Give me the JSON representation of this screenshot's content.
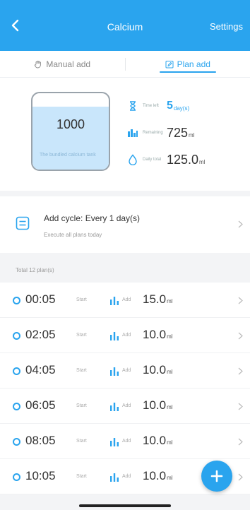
{
  "header": {
    "title": "Calcium",
    "settings_label": "Settings"
  },
  "tabs": [
    {
      "label": "Manual add",
      "icon": "hand-icon",
      "active": false
    },
    {
      "label": "Plan add",
      "icon": "calendar-edit-icon",
      "active": true
    }
  ],
  "summary": {
    "tank_volume": "1000",
    "tank_note": "The bundled calcium tank",
    "tank_fill_fraction": 0.82,
    "stats": [
      {
        "icon": "hourglass-icon",
        "label": "Time left",
        "value": "5",
        "unit": "day(s)",
        "highlight": true
      },
      {
        "icon": "bars-icon",
        "label": "Remaining",
        "value": "725",
        "unit": "ml",
        "highlight": false
      },
      {
        "icon": "drop-icon",
        "label": "Daily total",
        "value": "125.0",
        "unit": "ml",
        "highlight": false
      }
    ]
  },
  "cycle": {
    "title": "Add cycle: Every 1 day(s)",
    "subtitle": "Execute all plans today"
  },
  "total_label": "Total 12 plan(s)",
  "plans": [
    {
      "time": "00:05",
      "start_label": "Start",
      "add_label": "Add",
      "amount": "15.0",
      "unit": "ml"
    },
    {
      "time": "02:05",
      "start_label": "Start",
      "add_label": "Add",
      "amount": "10.0",
      "unit": "ml"
    },
    {
      "time": "04:05",
      "start_label": "Start",
      "add_label": "Add",
      "amount": "10.0",
      "unit": "ml"
    },
    {
      "time": "06:05",
      "start_label": "Start",
      "add_label": "Add",
      "amount": "10.0",
      "unit": "ml"
    },
    {
      "time": "08:05",
      "start_label": "Start",
      "add_label": "Add",
      "amount": "10.0",
      "unit": "ml"
    },
    {
      "time": "10:05",
      "start_label": "Start",
      "add_label": "Add",
      "amount": "10.0",
      "unit": "ml"
    }
  ],
  "colors": {
    "accent": "#2aa4ee",
    "background": "#f3f4f6",
    "water": "#c9e6fb"
  }
}
